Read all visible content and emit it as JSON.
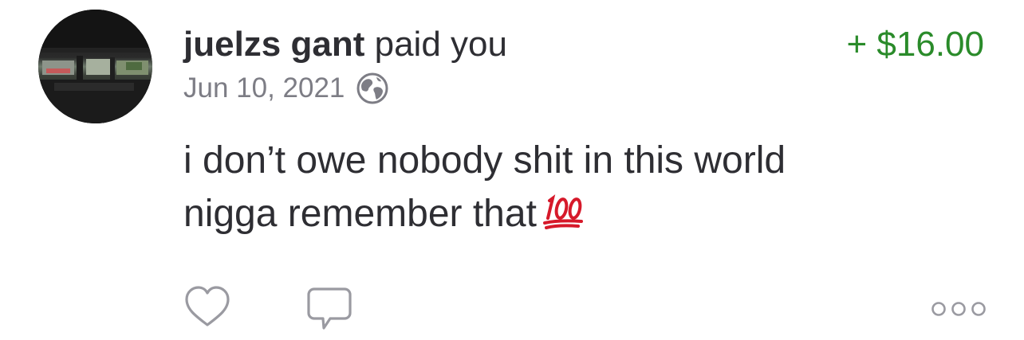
{
  "story": {
    "actor_name": "juelzs gant",
    "action_text": "paid you",
    "amount": "+ $16.00",
    "date": "Jun 10, 2021",
    "privacy_icon": "globe-icon",
    "note_line_1": "i don’t owe nobody shit in this world",
    "note_line_2": "nigga remember that",
    "note_emoji": "💯",
    "avatar": "avatar"
  },
  "actions": {
    "like_icon": "heart-icon",
    "comment_icon": "comment-icon",
    "more_icon": "more-icon"
  },
  "colors": {
    "amount": "#2a8b2a",
    "text": "#2e2e33",
    "secondary_text": "#7d7d85",
    "icon_gray": "#9a9aa1"
  }
}
